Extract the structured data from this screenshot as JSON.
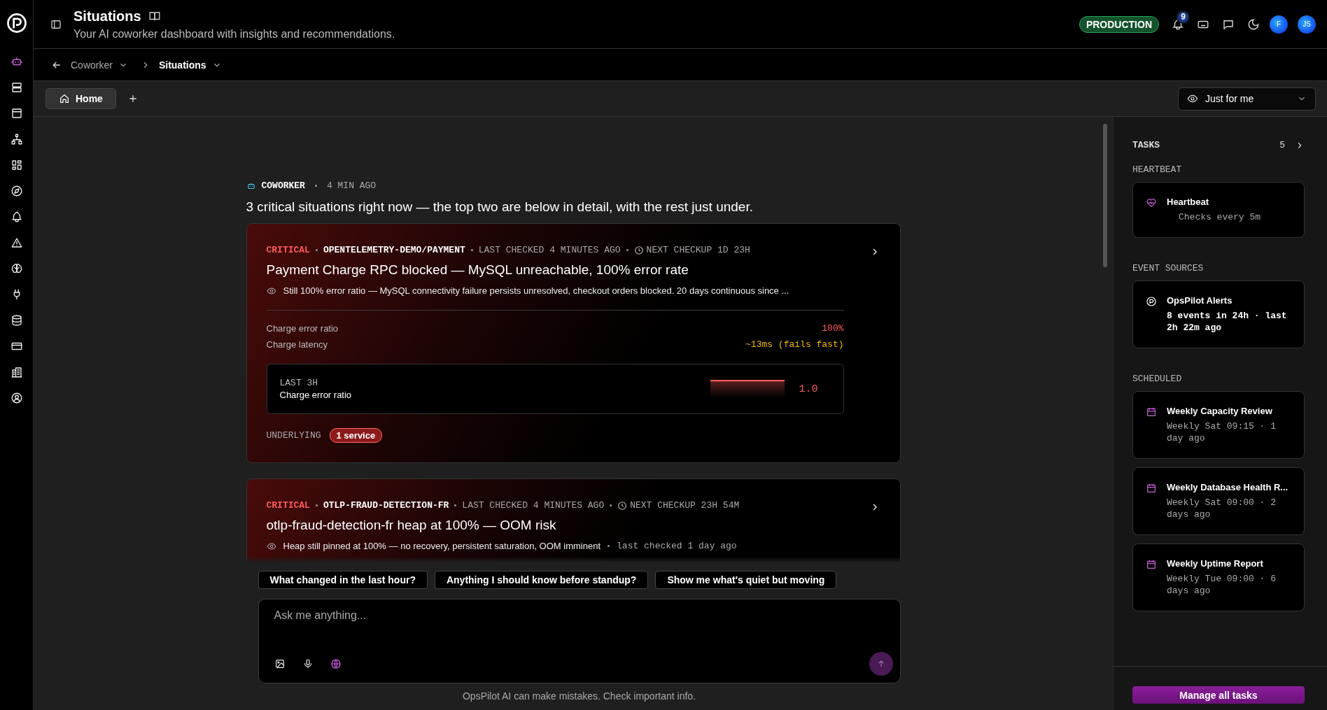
{
  "rail": {
    "nav": [
      {
        "selected": true
      },
      {
        "selected": false
      },
      {
        "selected": false
      },
      {
        "selected": false
      },
      {
        "selected": false
      },
      {
        "selected": false
      },
      {
        "selected": false
      },
      {
        "selected": false
      },
      {
        "selected": false
      },
      {
        "selected": false
      },
      {
        "selected": false
      },
      {
        "selected": false
      },
      {
        "selected": false
      },
      {
        "selected": false
      }
    ]
  },
  "header": {
    "title": "Situations",
    "subtitle": "Your AI coworker dashboard with insights and recommendations.",
    "environment": "PRODUCTION",
    "notification_count": "9",
    "avatars": [
      "F",
      "JS"
    ]
  },
  "breadcrumbs": [
    {
      "label": "Coworker",
      "selected": false
    },
    {
      "label": "Situations",
      "selected": true
    }
  ],
  "tabs": [
    {
      "label": "Home",
      "selected": true
    }
  ],
  "view_select": {
    "value": "Just for me"
  },
  "feed": {
    "source": "COWORKER",
    "time": "4 MIN AGO",
    "headline": "3 critical situations right now — the top two are below in detail, with the rest just under.",
    "situations": [
      {
        "severity": "CRITICAL",
        "service": "OPENTELEMETRY-DEMO/PAYMENT",
        "last_checked": "LAST CHECKED 4 MINUTES AGO",
        "next_checkup": "NEXT CHECKUP 1D 23H",
        "title": "Payment Charge RPC blocked — MySQL unreachable, 100% error rate",
        "summary": "Still 100% error ratio — MySQL connectivity failure persists unresolved, checkout orders blocked. 20 days continuous since ...",
        "metrics": [
          {
            "label": "Charge error ratio",
            "value": "100%",
            "color": "#ff5c5c"
          },
          {
            "label": "Charge latency",
            "value": "~13ms (fails fast)",
            "color": "#f5b800"
          }
        ],
        "trend": {
          "window": "LAST 3H",
          "label": "Charge error ratio",
          "value": "1.0"
        },
        "underlying_label": "UNDERLYING",
        "underlying": "1 service"
      },
      {
        "severity": "CRITICAL",
        "service": "OTLP-FRAUD-DETECTION-FR",
        "last_checked": "LAST CHECKED 4 MINUTES AGO",
        "next_checkup": "NEXT CHECKUP 23H 54M",
        "title": "otlp-fraud-detection-fr heap at 100% — OOM risk",
        "summary": "Heap still pinned at 100% — no recovery, persistent saturation, OOM imminent",
        "summary_note": "last checked 1 day ago"
      }
    ]
  },
  "suggestions": [
    "What changed in the last hour?",
    "Anything I should know before standup?",
    "Show me what's quiet but moving"
  ],
  "composer": {
    "placeholder": "Ask me anything..."
  },
  "disclaimer": "OpsPilot AI can make mistakes. Check important info.",
  "tasks": {
    "title": "TASKS",
    "count": "5",
    "sections": [
      {
        "heading": "HEARTBEAT",
        "items": [
          {
            "kind": "heartbeat",
            "title": "Heartbeat",
            "detail": "Checks every 5m"
          }
        ]
      },
      {
        "heading": "EVENT SOURCES",
        "items": [
          {
            "kind": "source",
            "title": "OpsPilot Alerts",
            "detail": "8 events in 24h · last 2h 22m ago"
          }
        ]
      },
      {
        "heading": "SCHEDULED",
        "items": [
          {
            "kind": "scheduled",
            "title": "Weekly Capacity Review",
            "detail": "Weekly Sat 09:15 · 1 day ago"
          },
          {
            "kind": "scheduled",
            "title": "Weekly Database Health R...",
            "detail": "Weekly Sat 09:00 · 2 days ago"
          },
          {
            "kind": "scheduled",
            "title": "Weekly Uptime Report",
            "detail": "Weekly Tue 09:00 · 6 days ago"
          }
        ]
      }
    ],
    "manage": "Manage all tasks"
  }
}
